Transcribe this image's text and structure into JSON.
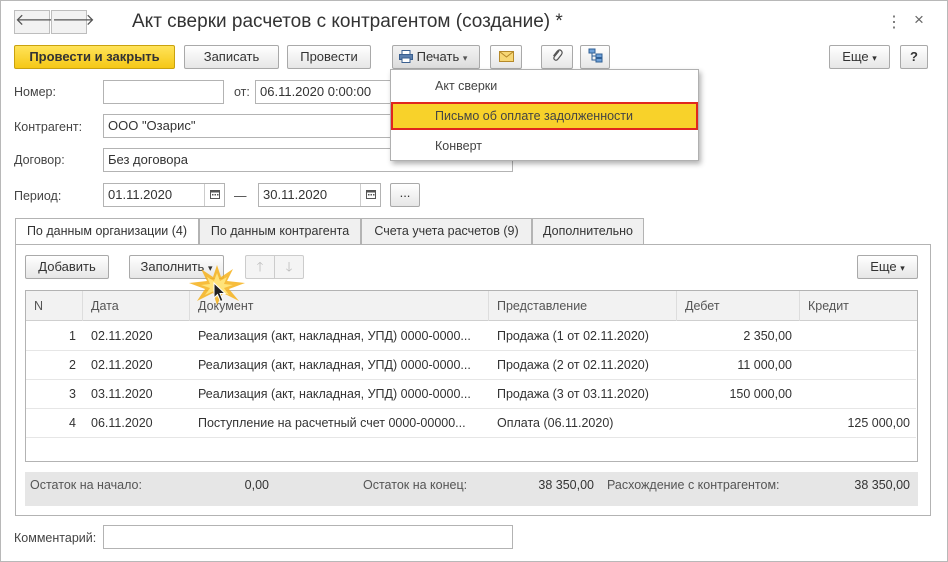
{
  "window": {
    "title": "Акт сверки расчетов с контрагентом (создание) *"
  },
  "icons": {
    "back": "arrow-left-icon",
    "forward": "arrow-right-icon",
    "more": "vertical-dots-icon",
    "close": "close-icon",
    "printer": "printer-icon",
    "mail": "envelope-icon",
    "attach": "paperclip-icon",
    "structure": "structure-icon",
    "calendar": "calendar-icon",
    "up": "arrow-up-icon",
    "down": "arrow-down-icon",
    "cursor": "mouse-pointer-icon"
  },
  "glyphs": {
    "back": "🡐",
    "forward": "🡒",
    "more": "⋮",
    "close": "×",
    "help": "?",
    "ellipsis": "...",
    "dash": "—",
    "caret": "▾",
    "up": "🡑",
    "down": "🡓"
  },
  "toolbar": {
    "post_close": "Провести и закрыть",
    "save": "Записать",
    "post": "Провести",
    "print": "Печать",
    "more": "Еще"
  },
  "print_menu": {
    "items": [
      "Акт сверки",
      "Письмо об оплате задолженности",
      "Конверт"
    ],
    "selected_index": 1
  },
  "form": {
    "number_label": "Номер:",
    "number_value": "",
    "from_label": "от:",
    "date_value": "06.11.2020  0:00:00",
    "counterparty_label": "Контрагент:",
    "counterparty_value": "ООО \"Озарис\"",
    "contract_label": "Договор:",
    "contract_value": "Без договора",
    "period_label": "Период:",
    "period_from": "01.11.2020",
    "period_to": "30.11.2020"
  },
  "tabs": [
    "По данным организации (4)",
    "По данным контрагента",
    "Счета учета расчетов (9)",
    "Дополнительно"
  ],
  "table_toolbar": {
    "add": "Добавить",
    "fill": "Заполнить",
    "more": "Еще"
  },
  "table": {
    "columns": [
      "N",
      "Дата",
      "Документ",
      "Представление",
      "Дебет",
      "Кредит"
    ],
    "rows": [
      {
        "n": "1",
        "date": "02.11.2020",
        "doc": "Реализация (акт, накладная, УПД) 0000-0000...",
        "repr": "Продажа (1 от 02.11.2020)",
        "debit": "2 350,00",
        "credit": ""
      },
      {
        "n": "2",
        "date": "02.11.2020",
        "doc": "Реализация (акт, накладная, УПД) 0000-0000...",
        "repr": "Продажа (2 от 02.11.2020)",
        "debit": "11 000,00",
        "credit": ""
      },
      {
        "n": "3",
        "date": "03.11.2020",
        "doc": "Реализация (акт, накладная, УПД) 0000-0000...",
        "repr": "Продажа (3 от 03.11.2020)",
        "debit": "150 000,00",
        "credit": ""
      },
      {
        "n": "4",
        "date": "06.11.2020",
        "doc": "Поступление на расчетный счет 0000-00000...",
        "repr": "Оплата (06.11.2020)",
        "debit": "",
        "credit": "125 000,00"
      }
    ]
  },
  "totals": {
    "start_label": "Остаток на начало:",
    "start_value": "0,00",
    "end_label": "Остаток на конец:",
    "end_value": "38 350,00",
    "diff_label": "Расхождение с контрагентом:",
    "diff_value": "38 350,00"
  },
  "comment": {
    "label": "Комментарий:",
    "value": ""
  },
  "colors": {
    "accent_yellow": "#f5c816",
    "highlight_border": "#e0271e",
    "footer_bg": "#e6e6e6"
  }
}
